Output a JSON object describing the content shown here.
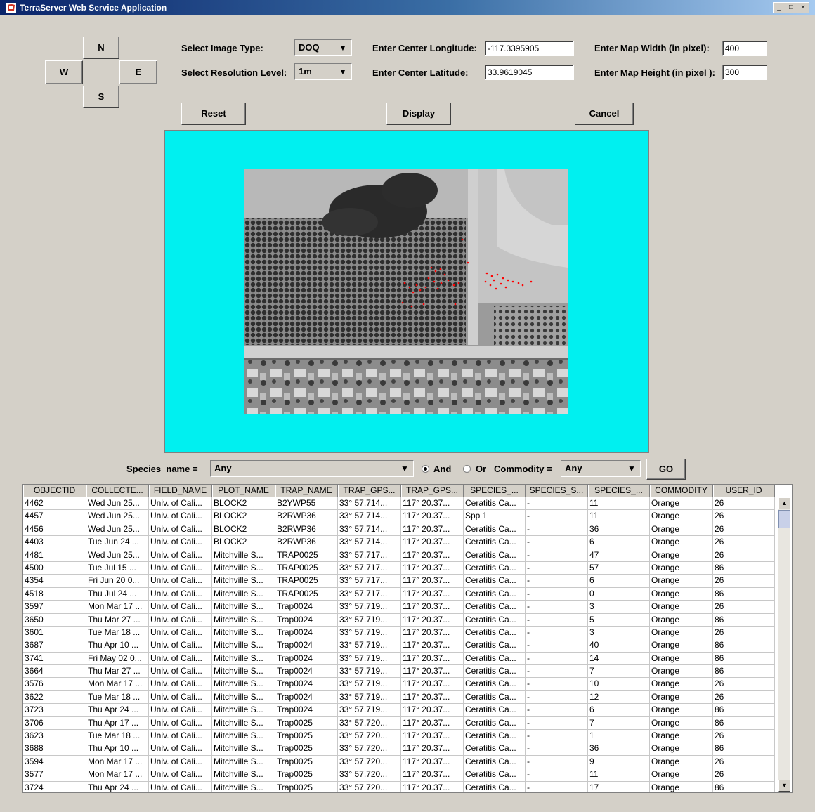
{
  "window": {
    "title": "TerraServer Web Service Application",
    "min": "_",
    "max": "□",
    "close": "×"
  },
  "nav": {
    "north": "N",
    "west": "W",
    "east": "E",
    "south": "S"
  },
  "controls": {
    "image_type_label": "Select Image Type:",
    "image_type_value": "DOQ",
    "resolution_label": "Select Resolution Level:",
    "resolution_value": "1m",
    "longitude_label": "Enter Center Longitude:",
    "longitude_value": "-117.3395905",
    "latitude_label": "Enter Center Latitude:",
    "latitude_value": "33.9619045",
    "width_label": "Enter Map Width (in pixel):",
    "width_value": "400",
    "height_label": "Enter Map Height (in pixel ):",
    "height_value": "300"
  },
  "buttons": {
    "reset": "Reset",
    "display": "Display",
    "cancel": "Cancel",
    "go": "GO"
  },
  "filter": {
    "species_label": "Species_name =",
    "species_value": "Any",
    "and_label": "And",
    "or_label": "Or",
    "commodity_label": "Commodity =",
    "commodity_value": "Any",
    "mode_selected": "And"
  },
  "colors": {
    "map_background": "#00f0f0",
    "trap_points": "#ff0000"
  },
  "table": {
    "columns": [
      "OBJECTID",
      "COLLECTE...",
      "FIELD_NAME",
      "PLOT_NAME",
      "TRAP_NAME",
      "TRAP_GPS...",
      "TRAP_GPS...",
      "SPECIES_...",
      "SPECIES_S...",
      "SPECIES_...",
      "COMMODITY",
      "USER_ID"
    ],
    "rows": [
      [
        "4462",
        "Wed Jun 25...",
        "Univ. of Cali...",
        "BLOCK2",
        "B2YWP55",
        "33° 57.714...",
        "117° 20.37...",
        "Ceratitis Ca...",
        "-",
        "11",
        "Orange",
        "26"
      ],
      [
        "4457",
        "Wed Jun 25...",
        "Univ. of Cali...",
        "BLOCK2",
        "B2RWP36",
        "33° 57.714...",
        "117° 20.37...",
        "Spp 1",
        "-",
        "11",
        "Orange",
        "26"
      ],
      [
        "4456",
        "Wed Jun 25...",
        "Univ. of Cali...",
        "BLOCK2",
        "B2RWP36",
        "33° 57.714...",
        "117° 20.37...",
        "Ceratitis Ca...",
        "-",
        "36",
        "Orange",
        "26"
      ],
      [
        "4403",
        "Tue Jun 24 ...",
        "Univ. of Cali...",
        "BLOCK2",
        "B2RWP36",
        "33° 57.714...",
        "117° 20.37...",
        "Ceratitis Ca...",
        "-",
        "6",
        "Orange",
        "26"
      ],
      [
        "4481",
        "Wed Jun 25...",
        "Univ. of Cali...",
        "Mitchville S...",
        "TRAP0025",
        "33° 57.717...",
        "117° 20.37...",
        "Ceratitis Ca...",
        "-",
        "47",
        "Orange",
        "26"
      ],
      [
        "4500",
        "Tue Jul 15 ...",
        "Univ. of Cali...",
        "Mitchville S...",
        "TRAP0025",
        "33° 57.717...",
        "117° 20.37...",
        "Ceratitis Ca...",
        "-",
        "57",
        "Orange",
        "86"
      ],
      [
        "4354",
        "Fri Jun 20 0...",
        "Univ. of Cali...",
        "Mitchville S...",
        "TRAP0025",
        "33° 57.717...",
        "117° 20.37...",
        "Ceratitis Ca...",
        "-",
        "6",
        "Orange",
        "26"
      ],
      [
        "4518",
        "Thu Jul 24 ...",
        "Univ. of Cali...",
        "Mitchville S...",
        "TRAP0025",
        "33° 57.717...",
        "117° 20.37...",
        "Ceratitis Ca...",
        "-",
        "0",
        "Orange",
        "86"
      ],
      [
        "3597",
        "Mon Mar 17 ...",
        "Univ. of Cali...",
        "Mitchville S...",
        "Trap0024",
        "33° 57.719...",
        "117° 20.37...",
        "Ceratitis Ca...",
        "-",
        "3",
        "Orange",
        "26"
      ],
      [
        "3650",
        "Thu Mar 27 ...",
        "Univ. of Cali...",
        "Mitchville S...",
        "Trap0024",
        "33° 57.719...",
        "117° 20.37...",
        "Ceratitis Ca...",
        "-",
        "5",
        "Orange",
        "86"
      ],
      [
        "3601",
        "Tue Mar 18 ...",
        "Univ. of Cali...",
        "Mitchville S...",
        "Trap0024",
        "33° 57.719...",
        "117° 20.37...",
        "Ceratitis Ca...",
        "-",
        "3",
        "Orange",
        "26"
      ],
      [
        "3687",
        "Thu Apr 10 ...",
        "Univ. of Cali...",
        "Mitchville S...",
        "Trap0024",
        "33° 57.719...",
        "117° 20.37...",
        "Ceratitis Ca...",
        "-",
        "40",
        "Orange",
        "86"
      ],
      [
        "3741",
        "Fri May 02 0...",
        "Univ. of Cali...",
        "Mitchville S...",
        "Trap0024",
        "33° 57.719...",
        "117° 20.37...",
        "Ceratitis Ca...",
        "-",
        "14",
        "Orange",
        "86"
      ],
      [
        "3664",
        "Thu Mar 27 ...",
        "Univ. of Cali...",
        "Mitchville S...",
        "Trap0024",
        "33° 57.719...",
        "117° 20.37...",
        "Ceratitis Ca...",
        "-",
        "7",
        "Orange",
        "86"
      ],
      [
        "3576",
        "Mon Mar 17 ...",
        "Univ. of Cali...",
        "Mitchville S...",
        "Trap0024",
        "33° 57.719...",
        "117° 20.37...",
        "Ceratitis Ca...",
        "-",
        "10",
        "Orange",
        "26"
      ],
      [
        "3622",
        "Tue Mar 18 ...",
        "Univ. of Cali...",
        "Mitchville S...",
        "Trap0024",
        "33° 57.719...",
        "117° 20.37...",
        "Ceratitis Ca...",
        "-",
        "12",
        "Orange",
        "26"
      ],
      [
        "3723",
        "Thu Apr 24 ...",
        "Univ. of Cali...",
        "Mitchville S...",
        "Trap0024",
        "33° 57.719...",
        "117° 20.37...",
        "Ceratitis Ca...",
        "-",
        "6",
        "Orange",
        "86"
      ],
      [
        "3706",
        "Thu Apr 17 ...",
        "Univ. of Cali...",
        "Mitchville S...",
        "Trap0025",
        "33° 57.720...",
        "117° 20.37...",
        "Ceratitis Ca...",
        "-",
        "7",
        "Orange",
        "86"
      ],
      [
        "3623",
        "Tue Mar 18 ...",
        "Univ. of Cali...",
        "Mitchville S...",
        "Trap0025",
        "33° 57.720...",
        "117° 20.37...",
        "Ceratitis Ca...",
        "-",
        "1",
        "Orange",
        "26"
      ],
      [
        "3688",
        "Thu Apr 10 ...",
        "Univ. of Cali...",
        "Mitchville S...",
        "Trap0025",
        "33° 57.720...",
        "117° 20.37...",
        "Ceratitis Ca...",
        "-",
        "36",
        "Orange",
        "86"
      ],
      [
        "3594",
        "Mon Mar 17 ...",
        "Univ. of Cali...",
        "Mitchville S...",
        "Trap0025",
        "33° 57.720...",
        "117° 20.37...",
        "Ceratitis Ca...",
        "-",
        "9",
        "Orange",
        "26"
      ],
      [
        "3577",
        "Mon Mar 17 ...",
        "Univ. of Cali...",
        "Mitchville S...",
        "Trap0025",
        "33° 57.720...",
        "117° 20.37...",
        "Ceratitis Ca...",
        "-",
        "11",
        "Orange",
        "26"
      ],
      [
        "3724",
        "Thu Apr 24 ...",
        "Univ. of Cali...",
        "Mitchville S...",
        "Trap0025",
        "33° 57.720...",
        "117° 20.37...",
        "Ceratitis Ca...",
        "-",
        "17",
        "Orange",
        "86"
      ]
    ]
  }
}
